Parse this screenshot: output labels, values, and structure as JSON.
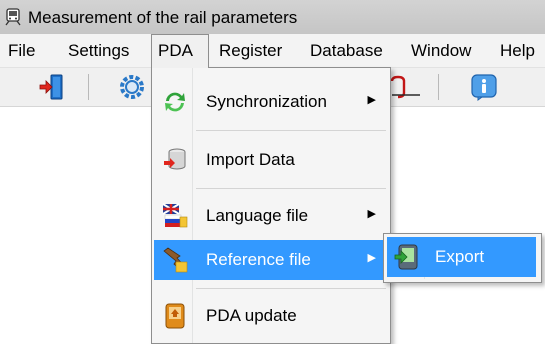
{
  "window": {
    "title": "Measurement of the rail parameters"
  },
  "menubar": {
    "items": [
      "File",
      "Settings",
      "PDA",
      "Register",
      "Database",
      "Window",
      "Help"
    ],
    "open_item": "PDA"
  },
  "toolbar": {
    "buttons": [
      "exit-door-icon",
      "settings-gear-icon",
      "rail-profile-icon",
      "info-icon"
    ]
  },
  "pda_menu": {
    "items": [
      {
        "label": "Synchronization",
        "icon": "sync-arrows-icon",
        "submenu": true
      },
      {
        "label": "Import Data",
        "icon": "database-import-icon",
        "submenu": false
      },
      {
        "label": "Language file",
        "icon": "flags-language-icon",
        "submenu": true
      },
      {
        "label": "Reference file",
        "icon": "rail-reference-icon",
        "submenu": true,
        "highlighted": true
      },
      {
        "label": "PDA update",
        "icon": "pda-update-icon",
        "submenu": false
      }
    ]
  },
  "reference_submenu": {
    "items": [
      {
        "label": "Export",
        "icon": "pda-export-icon",
        "highlighted": true
      }
    ]
  },
  "colors": {
    "highlight": "#3399ff",
    "menu_bg": "#f5f5f5",
    "titlebar": "#c8c8c8"
  }
}
